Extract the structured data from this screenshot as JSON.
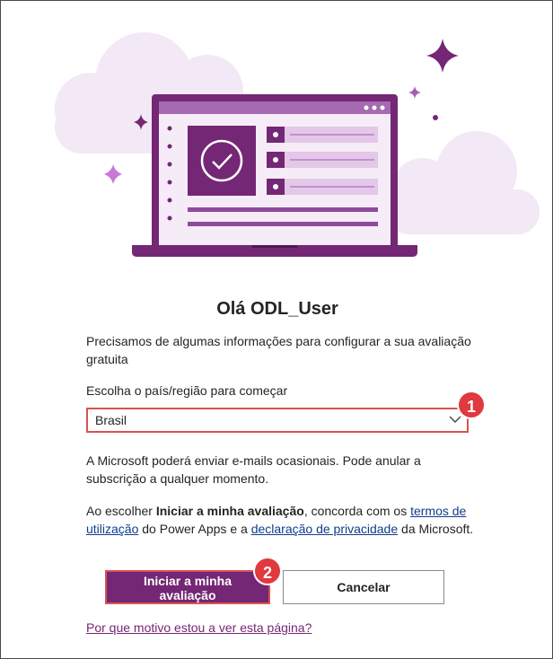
{
  "header": {
    "title": "Olá ODL_User"
  },
  "intro": {
    "text": "Precisamos de algumas informações para configurar a sua avaliação gratuita"
  },
  "country": {
    "label": "Escolha o país/região para começar",
    "selected": "Brasil"
  },
  "email_note": {
    "text": "A Microsoft poderá enviar e-mails ocasionais. Pode anular a subscrição a qualquer momento."
  },
  "terms": {
    "prefix": "Ao escolher ",
    "bold": "Iniciar a minha avaliação",
    "middle1": ", concorda com os ",
    "terms_link": "termos de utilização",
    "middle2": " do Power Apps e a ",
    "privacy_link": "declaração de privacidade",
    "suffix": " da Microsoft."
  },
  "buttons": {
    "start_line1": "Iniciar a minha",
    "start_line2": "avaliação",
    "cancel": "Cancelar"
  },
  "why_link": "Por que motivo estou a ver esta página?",
  "badges": {
    "one": "1",
    "two": "2"
  },
  "colors": {
    "brand_purple": "#742774",
    "cloud": "#f1e6f4",
    "badge_red": "#e0393e",
    "highlight_border": "#d9534f",
    "link_blue": "#0f3d8c"
  }
}
